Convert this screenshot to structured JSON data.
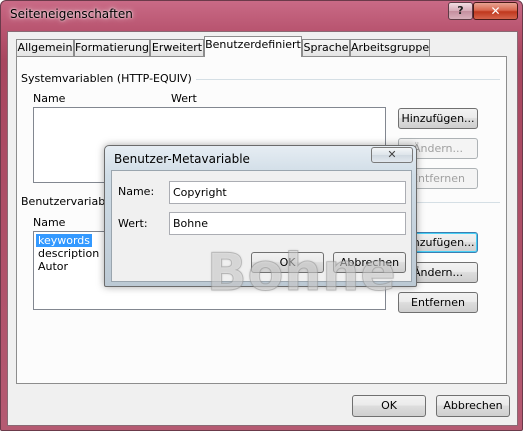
{
  "window": {
    "title": "Seiteneigenschaften",
    "help_label": "?",
    "close_label": "✕"
  },
  "tabs": [
    {
      "label": "Allgemein"
    },
    {
      "label": "Formatierung"
    },
    {
      "label": "Erweitert"
    },
    {
      "label": "Benutzerdefiniert",
      "active": true
    },
    {
      "label": "Sprache"
    },
    {
      "label": "Arbeitsgruppe"
    }
  ],
  "system_vars": {
    "group_label": "Systemvariablen (HTTP-EQUIV)",
    "col_name": "Name",
    "col_value": "Wert",
    "add_button": "Hinzufügen...",
    "change_button": "Ändern...",
    "remove_button": "Entfernen"
  },
  "user_vars": {
    "group_label": "Benutzervariablen",
    "col_name": "Name",
    "items": [
      "keywords",
      "description",
      "Autor"
    ],
    "selected_index": 0,
    "add_button": "Hinzufügen...",
    "change_button": "Ändern...",
    "remove_button": "Entfernen"
  },
  "footer": {
    "ok_button": "OK",
    "cancel_button": "Abbrechen"
  },
  "meta_dialog": {
    "title": "Benutzer-Metavariable",
    "close_label": "✕",
    "name_label": "Name:",
    "name_value": "Copyright",
    "value_label": "Wert:",
    "value_value": "Bohne",
    "ok_button": "OK",
    "cancel_button": "Abbrechen"
  },
  "watermark": "Bohne",
  "colors": {
    "titlebar": "#b8546f",
    "selection": "#3399ff",
    "close": "#c0381e"
  }
}
